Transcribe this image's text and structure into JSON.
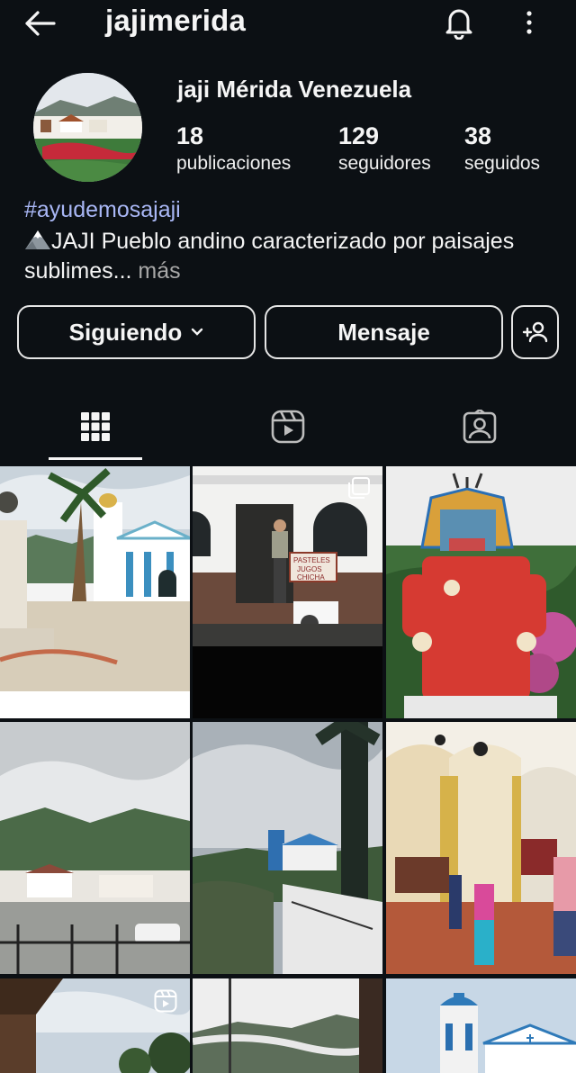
{
  "header": {
    "username": "jajimerida",
    "icons": {
      "back": "arrow-left-icon",
      "notifications": "bell-icon",
      "more": "more-vertical-icon"
    }
  },
  "profile": {
    "display_name": "jaji Mérida Venezuela",
    "stats": {
      "posts": {
        "count": "18",
        "label": "publicaciones"
      },
      "followers": {
        "count": "129",
        "label": "seguidores"
      },
      "following": {
        "count": "38",
        "label": "seguidos"
      }
    },
    "hashtag": "#ayudemosajaji",
    "bio_text": "JAJI Pueblo andino caracterizado por paisajes sublimes...",
    "bio_more": " más",
    "bio_emoji": "mountain-snow-icon"
  },
  "actions": {
    "following_label": "Siguiendo",
    "message_label": "Mensaje",
    "add_user_icon": "add-person-icon"
  },
  "tabs": [
    {
      "name": "grid",
      "icon": "grid-icon",
      "active": true
    },
    {
      "name": "reels",
      "icon": "reels-icon",
      "active": false
    },
    {
      "name": "tagged",
      "icon": "tagged-person-icon",
      "active": false
    }
  ],
  "posts": [
    {
      "subject": "plaza with church and statue",
      "badge": ""
    },
    {
      "subject": "house doorway with man",
      "badge": "multi-photo"
    },
    {
      "subject": "red giant diablo statue",
      "badge": ""
    },
    {
      "subject": "cloudy mountains over town",
      "badge": ""
    },
    {
      "subject": "church view with lamppost",
      "badge": ""
    },
    {
      "subject": "church interior with people",
      "badge": ""
    },
    {
      "subject": "roof and sky",
      "badge": "reel"
    },
    {
      "subject": "misty mountain",
      "badge": ""
    },
    {
      "subject": "blue white church tower",
      "badge": ""
    }
  ],
  "colors": {
    "background": "#0c1014",
    "hashtag": "#a9b7f5",
    "muted": "#a8a8a8",
    "text": "#f5f5f5"
  }
}
